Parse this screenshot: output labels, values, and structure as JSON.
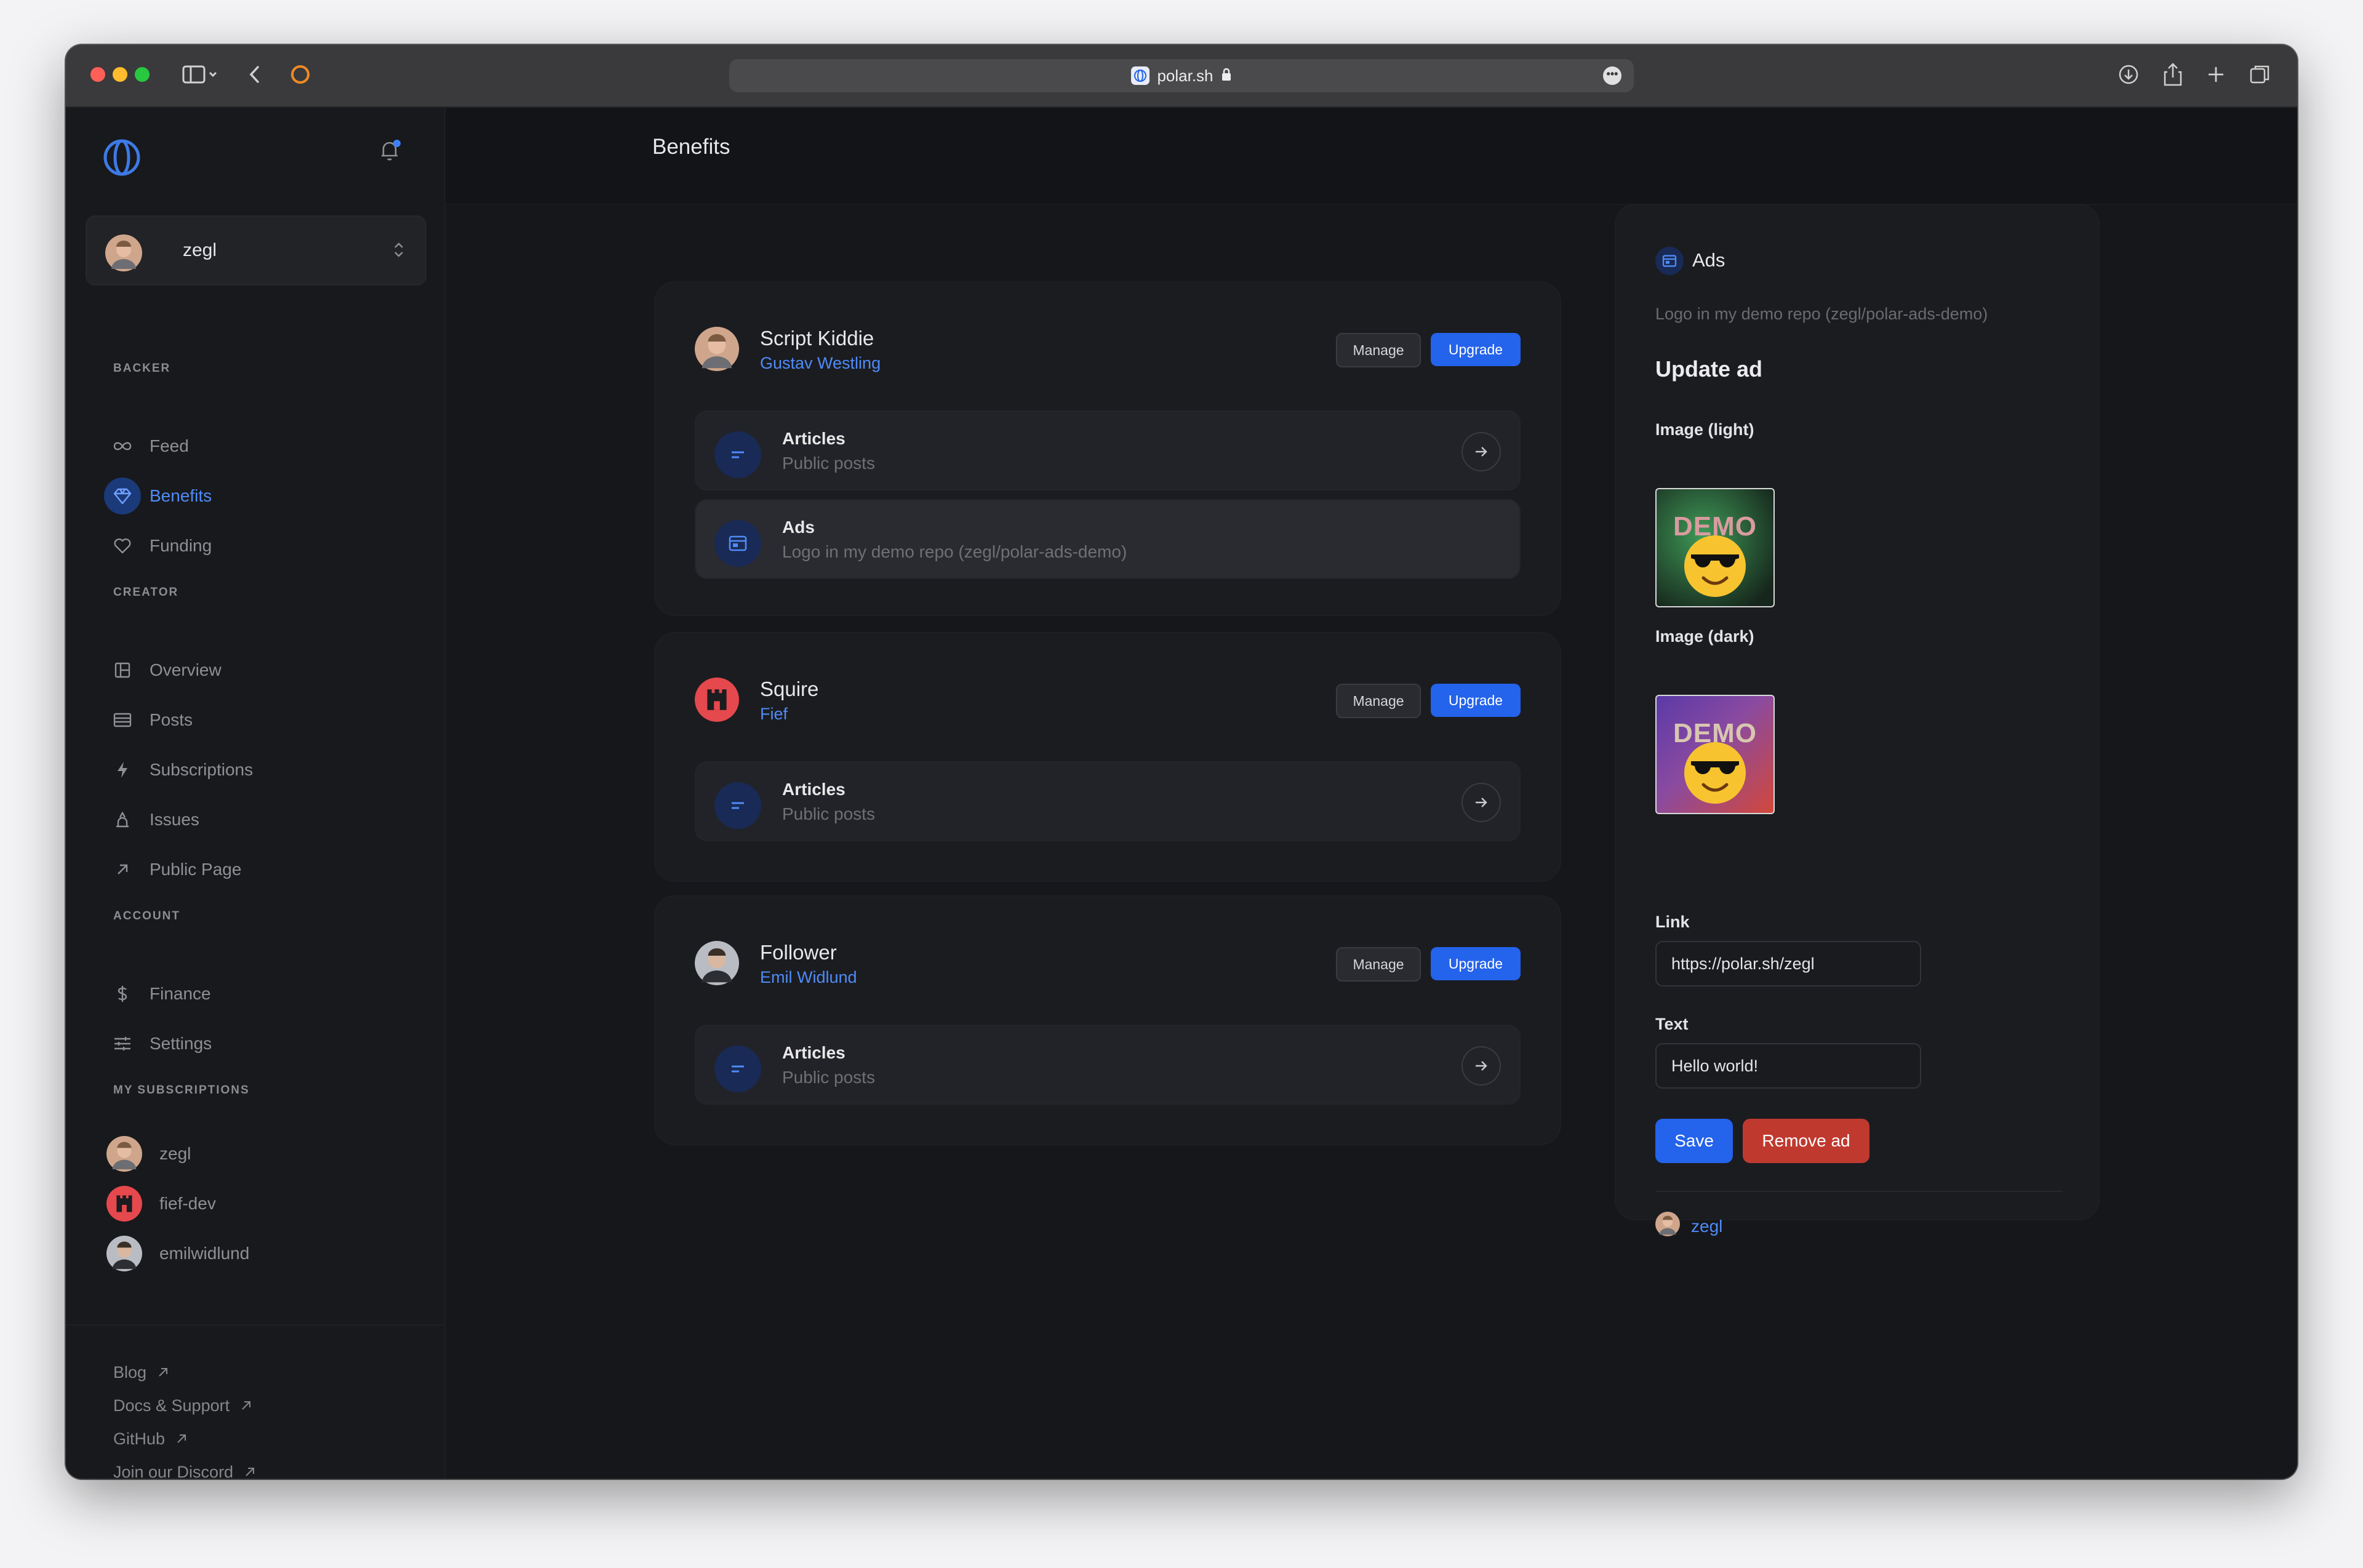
{
  "browser": {
    "url": "polar.sh"
  },
  "sidebar": {
    "account": {
      "name": "zegl"
    },
    "sections": {
      "backer": "BACKER",
      "creator": "CREATOR",
      "account": "ACCOUNT",
      "subscriptions": "MY SUBSCRIPTIONS"
    },
    "backer_items": [
      {
        "label": "Feed",
        "icon": "infinity-icon"
      },
      {
        "label": "Benefits",
        "icon": "diamond-icon",
        "active": true
      },
      {
        "label": "Funding",
        "icon": "heart-icon"
      }
    ],
    "creator_items": [
      {
        "label": "Overview",
        "icon": "layout-icon"
      },
      {
        "label": "Posts",
        "icon": "posts-icon"
      },
      {
        "label": "Subscriptions",
        "icon": "bolt-icon"
      },
      {
        "label": "Issues",
        "icon": "issues-icon"
      },
      {
        "label": "Public Page",
        "icon": "arrow-up-right-icon"
      }
    ],
    "account_items": [
      {
        "label": "Finance",
        "icon": "dollar-icon"
      },
      {
        "label": "Settings",
        "icon": "sliders-icon"
      }
    ],
    "subscriptions": [
      {
        "label": "zegl"
      },
      {
        "label": "fief-dev"
      },
      {
        "label": "emilwidlund"
      }
    ],
    "footer_links": [
      {
        "label": "Blog"
      },
      {
        "label": "Docs & Support"
      },
      {
        "label": "GitHub"
      },
      {
        "label": "Join our Discord"
      }
    ]
  },
  "header": {
    "title": "Benefits"
  },
  "tiers": [
    {
      "name": "Script Kiddie",
      "creator": "Gustav Westling",
      "manage_label": "Manage",
      "upgrade_label": "Upgrade",
      "benefits": [
        {
          "title": "Articles",
          "subtitle": "Public posts"
        },
        {
          "title": "Ads",
          "subtitle": "Logo in my demo repo (zegl/polar-ads-demo)"
        }
      ]
    },
    {
      "name": "Squire",
      "creator": "Fief",
      "manage_label": "Manage",
      "upgrade_label": "Upgrade",
      "benefits": [
        {
          "title": "Articles",
          "subtitle": "Public posts"
        }
      ]
    },
    {
      "name": "Follower",
      "creator": "Emil Widlund",
      "manage_label": "Manage",
      "upgrade_label": "Upgrade",
      "benefits": [
        {
          "title": "Articles",
          "subtitle": "Public posts"
        }
      ]
    }
  ],
  "ads_panel": {
    "title": "Ads",
    "description": "Logo in my demo repo (zegl/polar-ads-demo)",
    "heading": "Update ad",
    "image_light_label": "Image (light)",
    "image_dark_label": "Image (dark)",
    "image_text": "DEMO",
    "link_label": "Link",
    "link_value": "https://polar.sh/zegl",
    "text_label": "Text",
    "text_value": "Hello world!",
    "save_label": "Save",
    "remove_label": "Remove ad",
    "footer_user": "zegl"
  },
  "colors": {
    "accent": "#2463eb",
    "link": "#4f8bf8",
    "danger": "#c0392f",
    "background": "#16171a"
  }
}
